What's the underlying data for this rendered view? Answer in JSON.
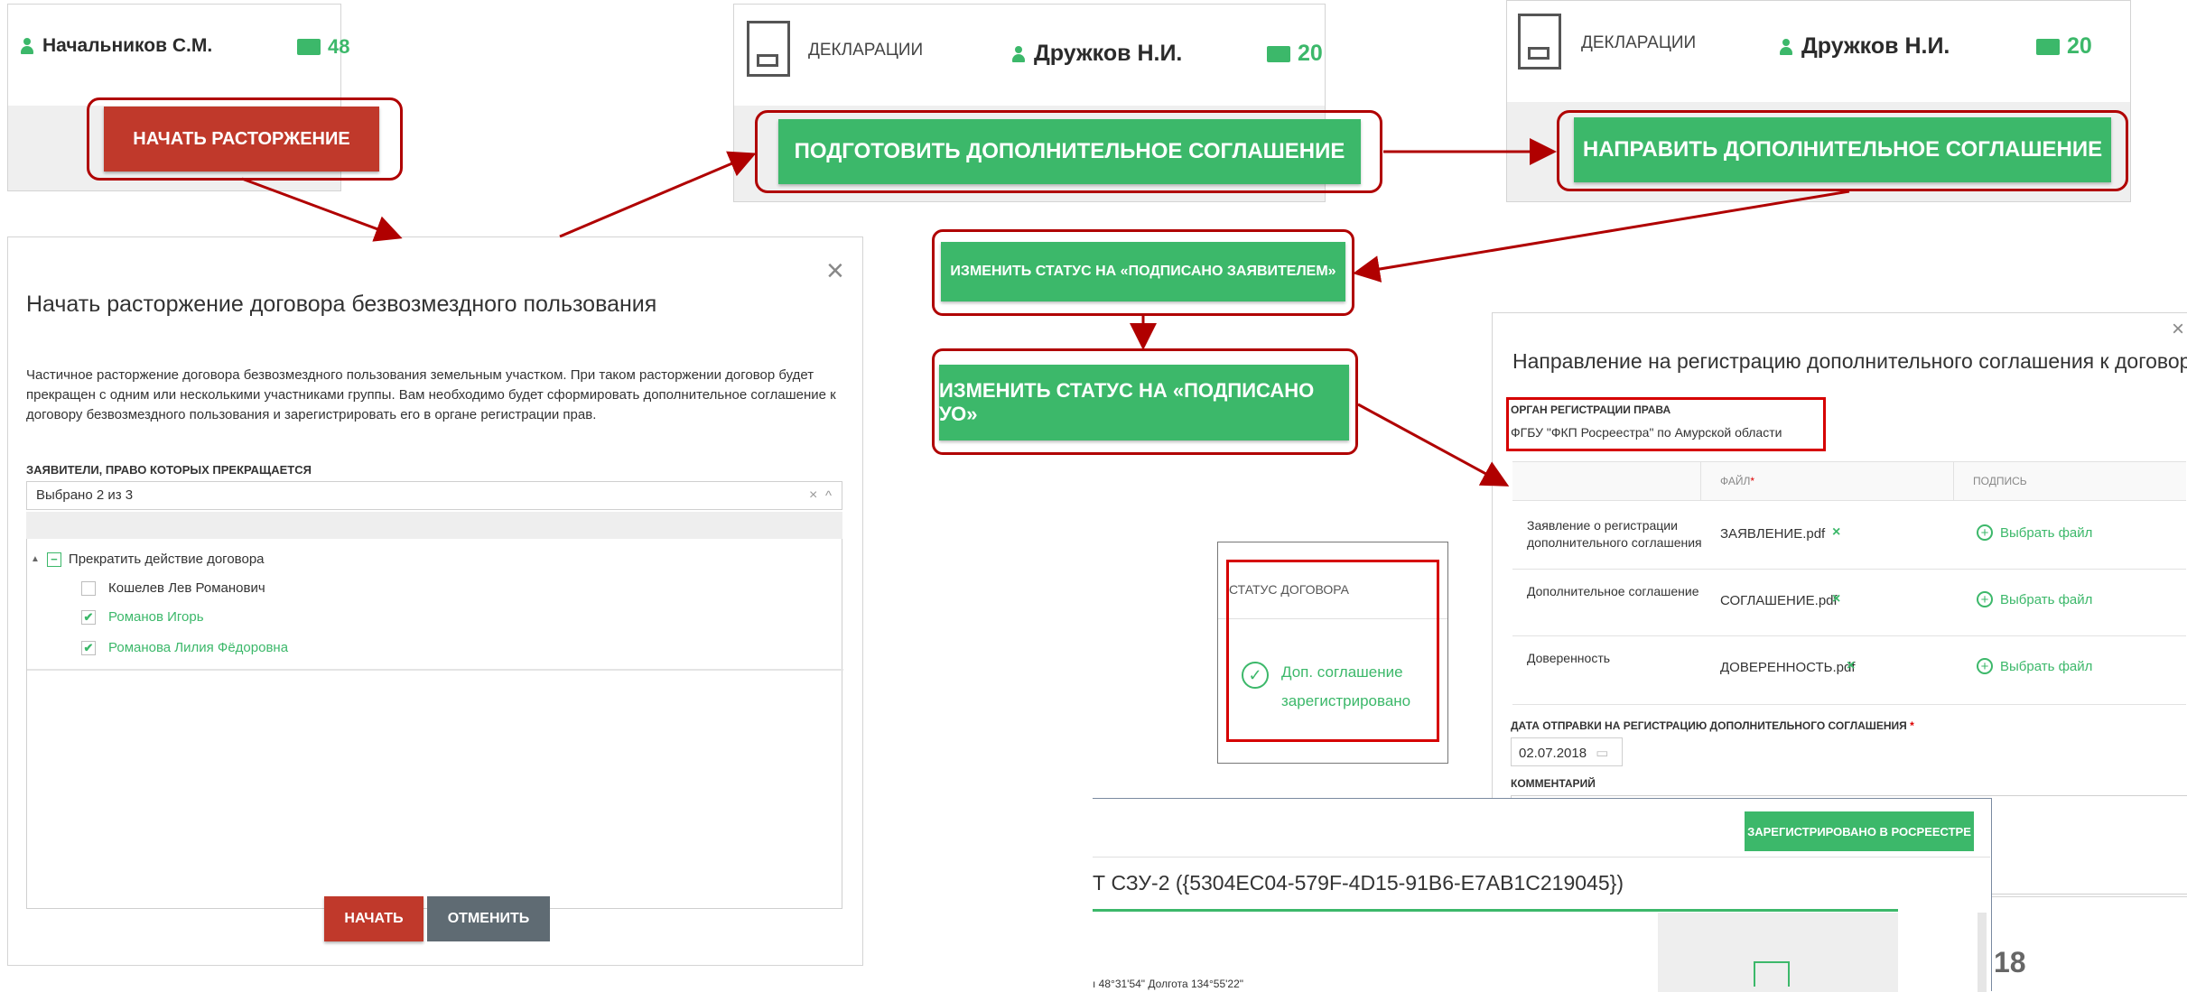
{
  "panel1": {
    "person": "Начальников С.М.",
    "mail_count": "48",
    "button": "НАЧАТЬ РАСТОРЖЕНИЕ"
  },
  "panel2": {
    "section": "ДЕКЛАРАЦИИ",
    "person": "Дружков Н.И.",
    "mail_count": "20",
    "button": "ПОДГОТОВИТЬ ДОПОЛНИТЕЛЬНОЕ СОГЛАШЕНИЕ"
  },
  "panel3": {
    "section": "ДЕКЛАРАЦИИ",
    "person": "Дружков Н.И.",
    "mail_count": "20",
    "button": "НАПРАВИТЬ ДОПОЛНИТЕЛЬНОЕ СОГЛАШЕНИЕ"
  },
  "status_buttons": {
    "signed_applicant": "ИЗМЕНИТЬ СТАТУС НА «ПОДПИСАНО ЗАЯВИТЕЛЕМ»",
    "signed_uo": "ИЗМЕНИТЬ СТАТУС НА «ПОДПИСАНО УО»"
  },
  "dialog": {
    "close": "×",
    "title": "Начать расторжение договора безвозмездного пользования",
    "description": "Частичное расторжение договора безвозмездного пользования земельным участком. При таком расторжении договор будет прекращен с одним или несколькими участниками группы. Вам необходимо будет сформировать дополнительное соглашение к договору безвозмездного пользования и зарегистрировать его в органе регистрации прав.",
    "applicants_label": "ЗАЯВИТЕЛИ, ПРАВО КОТОРЫХ ПРЕКРАЩАЕТСЯ",
    "selected_text": "Выбрано 2 из 3",
    "clear": "×",
    "caret": "^",
    "tree_root": "Прекратить действие договора",
    "items": [
      {
        "label": "Кошелев Лев Романович",
        "checked": false
      },
      {
        "label": "Романов Игорь",
        "checked": true
      },
      {
        "label": "Романова Лилия Фёдоровна",
        "checked": true
      }
    ],
    "start_button": "НАЧАТЬ",
    "cancel_button": "ОТМЕНИТЬ"
  },
  "registration": {
    "close": "×",
    "title": "Направление на регистрацию дополнительного соглашения к договору",
    "org_label": "ОРГАН РЕГИСТРАЦИИ ПРАВА",
    "org_value": "ФГБУ \"ФКП Росреестра\" по Амурской области",
    "col_file": "ФАЙЛ",
    "required_mark": "*",
    "col_sign": "ПОДПИСЬ",
    "rows": [
      {
        "name": "Заявление о регистрации дополнительного соглашения",
        "file": "ЗАЯВЛЕНИЕ.pdf",
        "remove": "×",
        "pick": "Выбрать файл"
      },
      {
        "name": "Дополнительное соглашение",
        "file": "СОГЛАШЕНИЕ.pdf",
        "remove": "×",
        "pick": "Выбрать файл"
      },
      {
        "name": "Доверенность",
        "file": "ДОВЕРЕННОСТЬ.pdf",
        "remove": "×",
        "pick": "Выбрать файл"
      }
    ],
    "date_label": "ДАТА ОТПРАВКИ НА РЕГИСТРАЦИЮ ДОПОЛНИТЕЛЬНОГО СОГЛАШЕНИЯ",
    "date_value": "02.07.2018",
    "comment_label": "КОММЕНТАРИЙ"
  },
  "status_panel": {
    "label": "СТАТУС ДОГОВОРА",
    "value_line1": "Доп. соглашение",
    "value_line2": "зарегистрировано"
  },
  "bottom_panel": {
    "badge": "ЗАРЕГИСТРИРОВАНО В РОСРЕЕСТРЕ",
    "title": "Т СЗУ-2 ({5304EC04-579F-4D15-91B6-E7AB1C219045})",
    "coords": "ı 48°31'54\" Долгота 134°55'22\""
  },
  "page_number": "18",
  "colors": {
    "green": "#3cb86a",
    "red_button": "#c0392b",
    "annotation_red": "#b00000",
    "grey_button": "#5f6b73"
  }
}
